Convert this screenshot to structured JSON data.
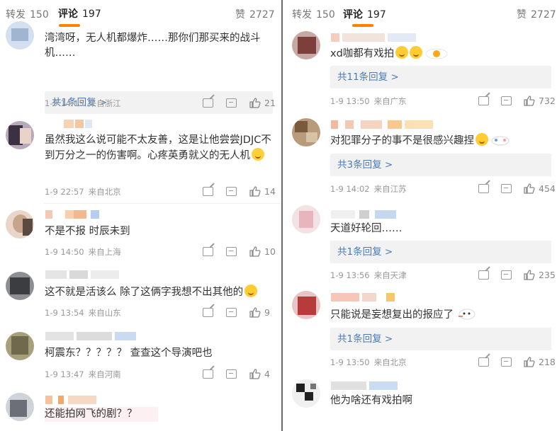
{
  "left": {
    "tabs": {
      "repost_label": "转发",
      "repost_count": "150",
      "comment_label": "评论",
      "comment_count": "197",
      "like_label": "赞",
      "like_count": "2727"
    },
    "comments": [
      {
        "text": "湾湾呀，无人机都爆炸……那你们那买来的战斗机……",
        "reply": "共1条回复 >",
        "date": "1-9 14:15",
        "location": "来自浙江",
        "likes": "21"
      },
      {
        "text": "虽然我这么说可能不太友善，这是让他尝尝JDJC不到万分之一的伤害啊。心疼英勇就义的无人机",
        "emoji": "hug-emoji",
        "date": "1-9 22:57",
        "location": "来自北京",
        "likes": "14"
      },
      {
        "text": "不是不报 时辰未到",
        "date": "1-9 14:50",
        "location": "来自上海",
        "likes": "10"
      },
      {
        "text": "这不就是活该么 除了这俩字我想不出其他的",
        "emoji": "sleepy-emoji",
        "date": "1-9 13:54",
        "location": "来自山东",
        "likes": "9"
      },
      {
        "text": "柯震东？？？？？ 查查这个导演吧也",
        "date": "1-9 13:47",
        "location": "来自河南",
        "likes": "4"
      },
      {
        "text": "还能拍网飞的剧？？"
      }
    ]
  },
  "right": {
    "tabs": {
      "repost_label": "转发",
      "repost_count": "150",
      "comment_label": "评论",
      "comment_count": "197",
      "like_label": "赞",
      "like_count": "2727"
    },
    "comments": [
      {
        "text": "xd咖都有戏拍",
        "emoji": "grin-emoji",
        "sticker": "egg-sticker",
        "reply": "共11条回复 >",
        "date": "1-9 13:50",
        "location": "来自广东",
        "likes": "732"
      },
      {
        "text": "对犯罪分子的事不是很感兴趣捏",
        "emoji": "tongue-emoji",
        "sticker": "cat-sticker",
        "reply": "共3条回复 >",
        "date": "1-9 14:02",
        "location": "来自江苏",
        "likes": "454"
      },
      {
        "text": "天道好轮回……",
        "reply": "共1条回复 >",
        "date": "1-9 13:56",
        "location": "来自天津",
        "likes": "235"
      },
      {
        "text": "只能说是妄想复出的报应了",
        "sticker": "bunny-sticker",
        "reply": "共1条回复 >",
        "date": "1-9 13:50",
        "location": "来自北京",
        "likes": "218"
      },
      {
        "text": "他为啥还有戏拍啊"
      }
    ]
  },
  "colors": {
    "accent": "#ff8200",
    "link": "#4a7bb7",
    "meta": "#999999",
    "reply_bg": "#f2f2f2",
    "divider": "#6b6b6b"
  }
}
